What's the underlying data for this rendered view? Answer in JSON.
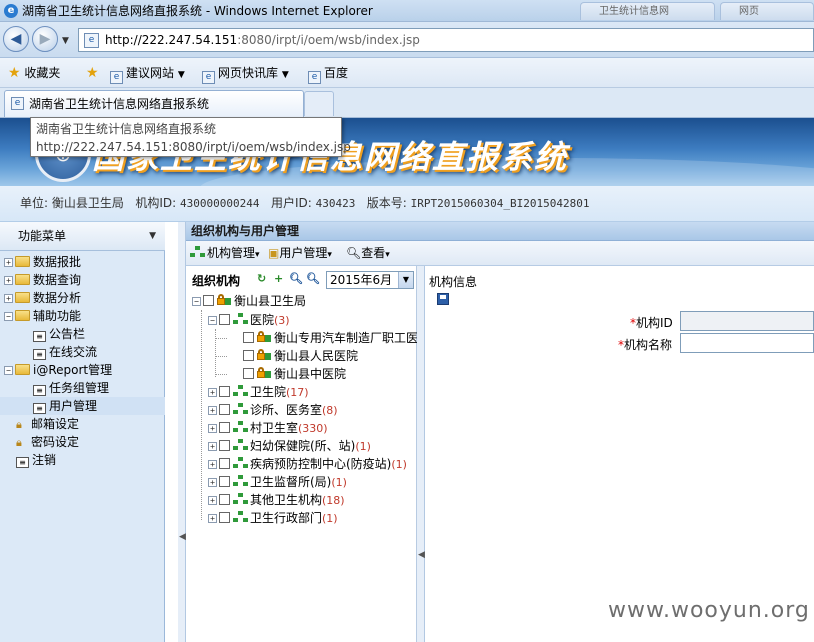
{
  "window": {
    "title": "湖南省卫生统计信息网络直报系统 - Windows Internet Explorer",
    "ghost_tab1": "卫生统计信息网",
    "ghost_tab2": "网页"
  },
  "browser": {
    "url_host": "http://222.247.54.151",
    "url_path": ":8080/irpt/i/oem/wsb/index.jsp"
  },
  "favorites": {
    "label": "收藏夹",
    "items": [
      {
        "label": "建议网站"
      },
      {
        "label": "网页快讯库"
      },
      {
        "label": "百度"
      }
    ]
  },
  "tab": {
    "label": "湖南省卫生统计信息网络直报系统"
  },
  "tooltip": {
    "line1": "湖南省卫生统计信息网络直报系统",
    "line2": "http://222.247.54.151:8080/irpt/i/oem/wsb/index.jsp"
  },
  "banner": {
    "title": "国家卫生统计信息网络直报系统"
  },
  "info": {
    "unit_label": "单位:",
    "unit_value": "衡山县卫生局",
    "org_id_label": "机构ID:",
    "org_id_value": "430000000244",
    "user_id_label": "用户ID:",
    "user_id_value": "430423",
    "version_label": "版本号:",
    "version_value": "IRPT2015060304_BI2015042801"
  },
  "menu": {
    "header": "功能菜单",
    "items": [
      {
        "label": "数据报批"
      },
      {
        "label": "数据查询"
      },
      {
        "label": "数据分析"
      },
      {
        "label": "辅助功能"
      },
      {
        "label": "公告栏"
      },
      {
        "label": "在线交流"
      },
      {
        "label": "i@Report管理"
      },
      {
        "label": "任务组管理"
      },
      {
        "label": "用户管理"
      },
      {
        "label": "邮箱设定"
      },
      {
        "label": "密码设定"
      },
      {
        "label": "注销"
      }
    ]
  },
  "main": {
    "title": "组织机构与用户管理",
    "toolbar": {
      "org_mgmt": "机构管理",
      "user_mgmt": "用户管理",
      "view": "查看"
    },
    "org_panel": {
      "title": "组织机构",
      "month": "2015年6月"
    },
    "tree": {
      "root": "衡山县卫生局",
      "hospital": "医院",
      "hospital_count": "(3)",
      "h1": "衡山专用汽车制造厂职工医院",
      "h2": "衡山县人民医院",
      "h3": "衡山县中医院",
      "n1": "卫生院",
      "n1_count": "(17)",
      "n2": "诊所、医务室",
      "n2_count": "(8)",
      "n3": "村卫生室",
      "n3_count": "(330)",
      "n4": "妇幼保健院(所、站)",
      "n4_count": "(1)",
      "n5": "疾病预防控制中心(防疫站)",
      "n5_count": "(1)",
      "n6": "卫生监督所(局)",
      "n6_count": "(1)",
      "n7": "其他卫生机构",
      "n7_count": "(18)",
      "n8": "卫生行政部门",
      "n8_count": "(1)"
    },
    "info_panel": {
      "title": "机构信息",
      "org_id_label": "机构ID",
      "org_name_label": "机构名称",
      "required_mark": "*"
    }
  },
  "watermark": "www.wooyun.org"
}
